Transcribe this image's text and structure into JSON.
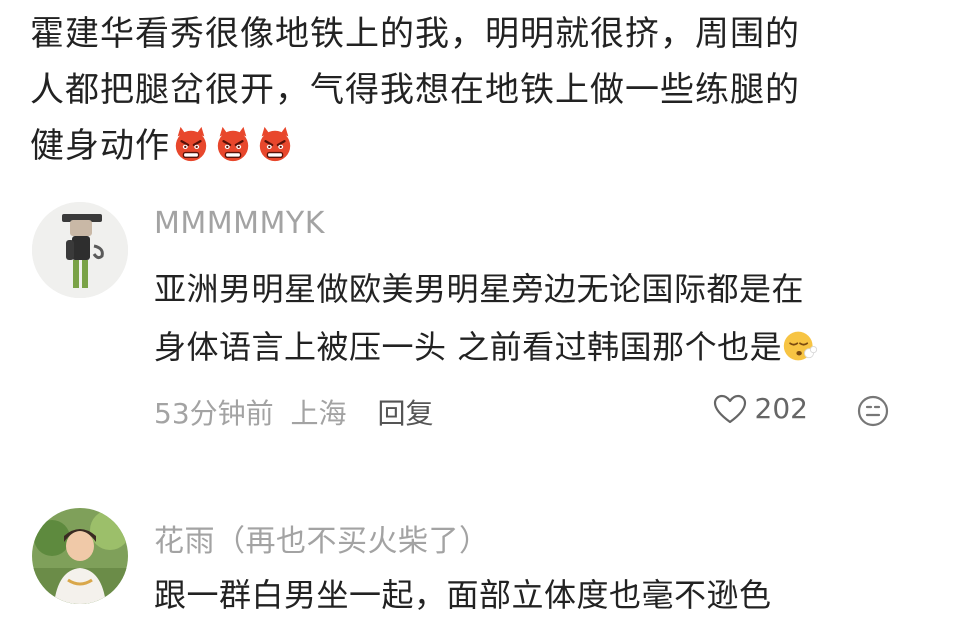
{
  "post": {
    "lines": [
      "霍建华看秀很像地铁上的我，明明就很挤，周围的",
      "人都把腿岔很开，气得我想在地铁上做一些练腿的",
      "健身动作"
    ],
    "trailing_emojis": [
      "angry-devil-emoji",
      "angry-devil-emoji",
      "angry-devil-emoji"
    ]
  },
  "comments": [
    {
      "username": "MMMMMYK",
      "lines": [
        "亚洲男明星做欧美男明星旁边无论国际都是在",
        "身体语言上被压一头 之前看过韩国那个也是"
      ],
      "inline_emoji": "exhale-face-emoji",
      "time": "53分钟前",
      "location": "上海",
      "reply_label": "回复",
      "likes": "202"
    },
    {
      "username": "花雨（再也不买火柴了）",
      "lines": [
        "跟一群白男坐一起，面部立体度也毫不逊色"
      ]
    }
  ],
  "colors": {
    "text": "#222222",
    "muted": "#a3a3a3",
    "devil": "#e8472c"
  }
}
